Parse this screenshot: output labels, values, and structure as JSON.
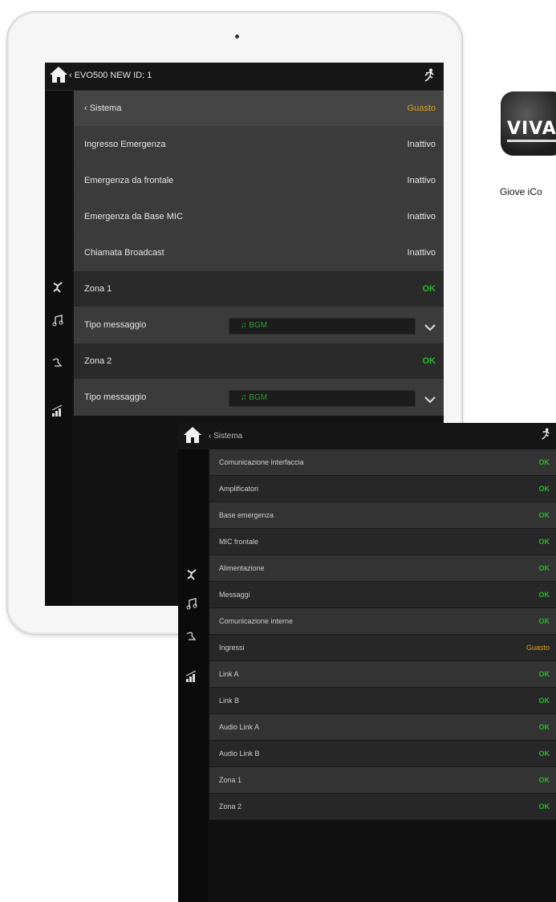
{
  "tablet": {
    "breadcrumb": "‹ EVO500 NEW ID: 1",
    "rows": [
      {
        "label": "‹ Sistema",
        "value": "Guasto",
        "status": "fault",
        "style": "hdr"
      },
      {
        "label": "Ingresso Emergenza",
        "value": "Inattivo",
        "status": "normal",
        "style": "light"
      },
      {
        "label": "Emergenza da frontale",
        "value": "Inattivo",
        "status": "normal",
        "style": "light"
      },
      {
        "label": "Emergenza da Base MIC",
        "value": "Inattivo",
        "status": "normal",
        "style": "light"
      },
      {
        "label": "Chiamata Broadcast",
        "value": "Inattivo",
        "status": "normal",
        "style": "light"
      },
      {
        "label": "Zona 1",
        "value": "OK",
        "status": "ok",
        "style": "dark"
      },
      {
        "label": "Tipo messaggio",
        "select": "♫ BGM",
        "style": "light"
      },
      {
        "label": "Zona 2",
        "value": "OK",
        "status": "ok",
        "style": "dark"
      },
      {
        "label": "Tipo messaggio",
        "select": "♫ BGM",
        "style": "light"
      }
    ]
  },
  "panel": {
    "breadcrumb": "‹ Sistema",
    "rows": [
      {
        "label": "Comunicazione interfaccia",
        "value": "OK",
        "status": "ok"
      },
      {
        "label": "Amplificatori",
        "value": "OK",
        "status": "ok"
      },
      {
        "label": "Base emergenza",
        "value": "OK",
        "status": "ok"
      },
      {
        "label": "MIC frontale",
        "value": "OK",
        "status": "ok"
      },
      {
        "label": "Alimentazione",
        "value": "OK",
        "status": "ok"
      },
      {
        "label": "Messaggi",
        "value": "OK",
        "status": "ok"
      },
      {
        "label": "Comunicazione interne",
        "value": "OK",
        "status": "ok"
      },
      {
        "label": "Ingressi",
        "value": "Guasto",
        "status": "fault"
      },
      {
        "label": "Link A",
        "value": "OK",
        "status": "ok"
      },
      {
        "label": "Link B",
        "value": "OK",
        "status": "ok"
      },
      {
        "label": "Audio Link A",
        "value": "OK",
        "status": "ok"
      },
      {
        "label": "Audio Link B",
        "value": "OK",
        "status": "ok"
      },
      {
        "label": "Zona 1",
        "value": "OK",
        "status": "ok"
      },
      {
        "label": "Zona 2",
        "value": "OK",
        "status": "ok"
      }
    ]
  },
  "app": {
    "brand": "VIVAL",
    "name": "Giove iCo"
  },
  "colors": {
    "ok": "#29b52d",
    "fault": "#d9a21b"
  }
}
